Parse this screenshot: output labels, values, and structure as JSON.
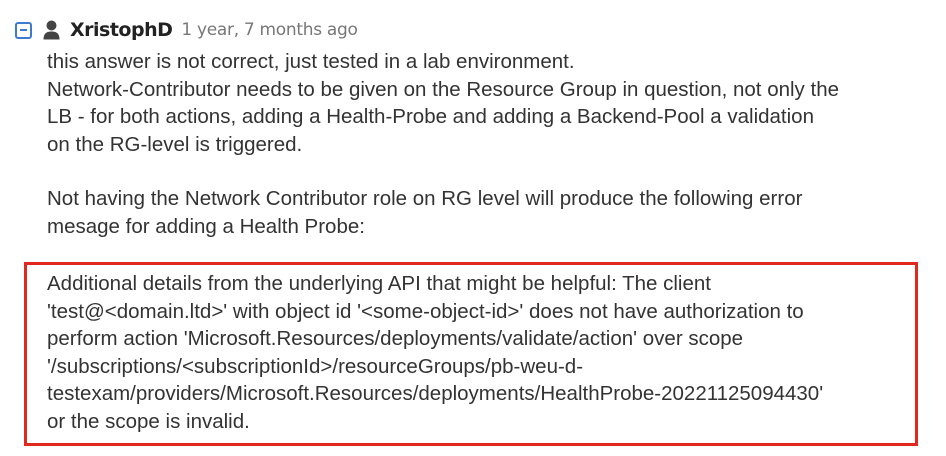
{
  "comment": {
    "username": "XristophD",
    "timestamp": "1 year, 7 months ago",
    "icons": {
      "collapse": "collapse-minus-icon",
      "user": "user-icon"
    },
    "paragraph_1": [
      "this answer is not correct, just tested in a lab environment.",
      "Network-Contributor needs to be given on the Resource Group in question, not only the",
      "LB - for both actions, adding a Health-Probe and adding a Backend-Pool a validation",
      "on the RG-level is triggered."
    ],
    "paragraph_2": [
      "Not having the Network Contributor role on RG level will produce the following error",
      "mesage for adding a Health Probe:"
    ],
    "error_message": [
      "Additional details from the underlying API that might be helpful: The client",
      "'test@<domain.ltd>' with object id '<some-object-id>' does not have authorization to",
      "perform action 'Microsoft.Resources/deployments/validate/action' over scope",
      "'/subscriptions/<subscriptionId>/resourceGroups/pb-weu-d-",
      "testexam/providers/Microsoft.Resources/deployments/HealthProbe-20221125094430'",
      "or the scope is invalid."
    ]
  },
  "colors": {
    "accent_blue": "#3d7bd1",
    "highlight_red": "#e0281e",
    "text": "#333333",
    "muted": "#777777"
  }
}
